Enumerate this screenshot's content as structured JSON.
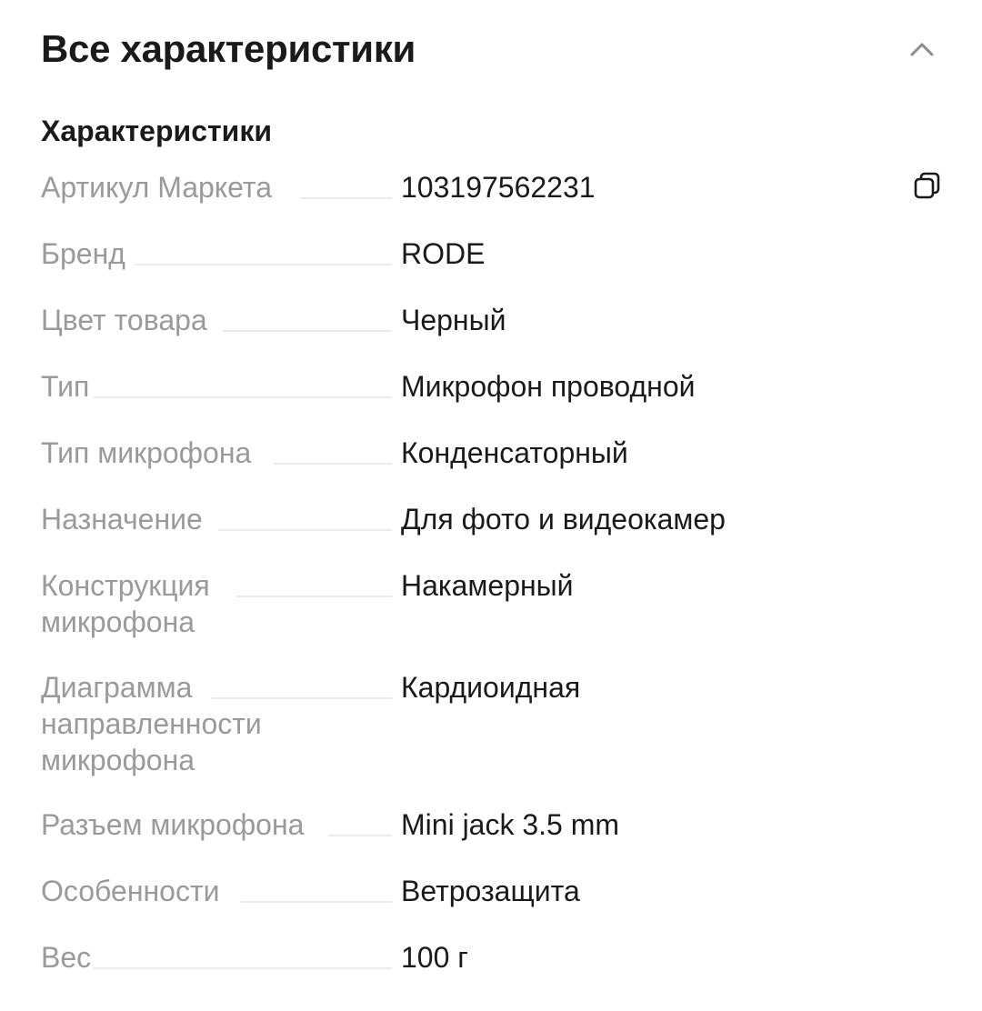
{
  "header": {
    "title": "Все характеристики",
    "collapse_icon": "chevron-up-icon"
  },
  "section": {
    "title": "Характеристики"
  },
  "copy_icon": "copy-icon",
  "specs": [
    {
      "label": "Артикул Маркета",
      "value": "103197562231"
    },
    {
      "label": "Бренд",
      "value": "RODE"
    },
    {
      "label": "Цвет товара",
      "value": "Черный"
    },
    {
      "label": "Тип",
      "value": "Микрофон проводной"
    },
    {
      "label": "Тип микрофона",
      "value": "Конденсаторный"
    },
    {
      "label": "Назначение",
      "value": "Для фото и видеокамер"
    },
    {
      "label": "Конструкция\nмикрофона",
      "value": "Накамерный"
    },
    {
      "label": "Диаграмма\nнаправленности\nмикрофона",
      "value": "Кардиоидная"
    },
    {
      "label": "Разъем микрофона",
      "value": "Mini jack 3.5 mm"
    },
    {
      "label": "Особенности",
      "value": "Ветрозащита"
    },
    {
      "label": "Вес",
      "value": "100 г"
    }
  ]
}
